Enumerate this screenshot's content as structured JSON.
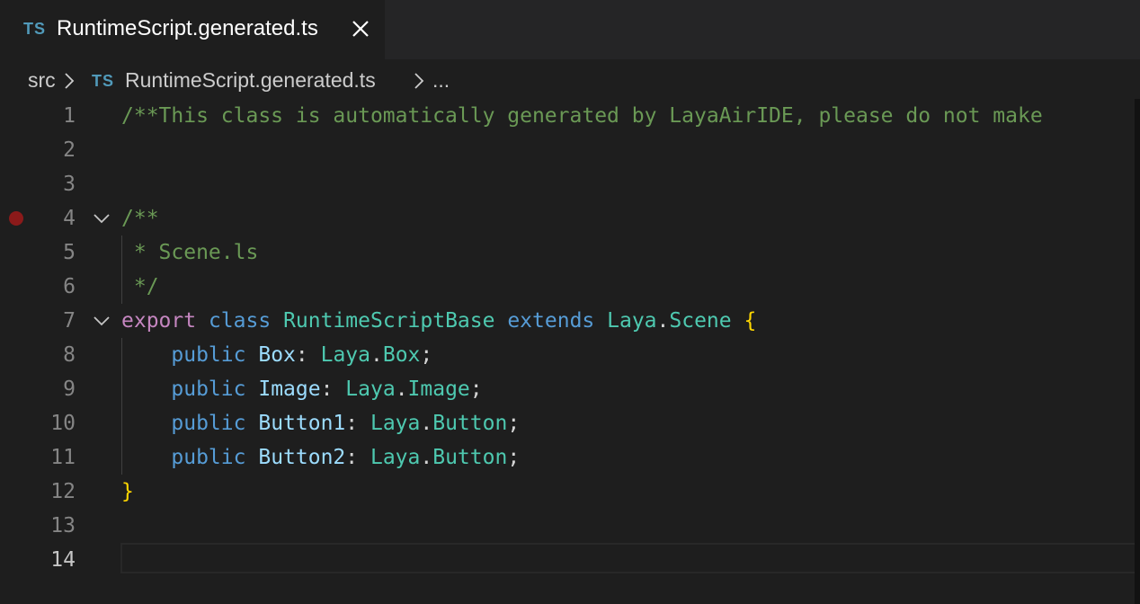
{
  "tab": {
    "icon_text": "TS",
    "label": "RuntimeScript.generated.ts"
  },
  "breadcrumb": {
    "folder": "src",
    "icon_text": "TS",
    "file": "RuntimeScript.generated.ts",
    "more": "..."
  },
  "editor": {
    "current_line": 14,
    "breakpoint_line": 4,
    "lines": [
      {
        "n": "1",
        "tokens": [
          {
            "t": "/**This class is automatically generated by LayaAirIDE, please do not make",
            "c": "c-comment"
          }
        ]
      },
      {
        "n": "2",
        "tokens": []
      },
      {
        "n": "3",
        "tokens": []
      },
      {
        "n": "4",
        "tokens": [
          {
            "t": "/**",
            "c": "c-comment"
          }
        ]
      },
      {
        "n": "5",
        "tokens": [
          {
            "t": " * Scene.ls",
            "c": "c-comment"
          }
        ]
      },
      {
        "n": "6",
        "tokens": [
          {
            "t": " */",
            "c": "c-comment"
          }
        ]
      },
      {
        "n": "7",
        "tokens": [
          {
            "t": "export",
            "c": "c-kw-export"
          },
          {
            "t": " ",
            "c": "c-punct"
          },
          {
            "t": "class",
            "c": "c-keyword"
          },
          {
            "t": " ",
            "c": "c-punct"
          },
          {
            "t": "RuntimeScriptBase",
            "c": "c-type"
          },
          {
            "t": " ",
            "c": "c-punct"
          },
          {
            "t": "extends",
            "c": "c-keyword"
          },
          {
            "t": " ",
            "c": "c-punct"
          },
          {
            "t": "Laya",
            "c": "c-type"
          },
          {
            "t": ".",
            "c": "c-punct"
          },
          {
            "t": "Scene",
            "c": "c-type"
          },
          {
            "t": " ",
            "c": "c-punct"
          },
          {
            "t": "{",
            "c": "c-brace"
          }
        ]
      },
      {
        "n": "8",
        "tokens": [
          {
            "t": "    ",
            "c": "c-punct"
          },
          {
            "t": "public",
            "c": "c-keyword"
          },
          {
            "t": " ",
            "c": "c-punct"
          },
          {
            "t": "Box",
            "c": "c-prop"
          },
          {
            "t": ": ",
            "c": "c-punct"
          },
          {
            "t": "Laya",
            "c": "c-type"
          },
          {
            "t": ".",
            "c": "c-punct"
          },
          {
            "t": "Box",
            "c": "c-type"
          },
          {
            "t": ";",
            "c": "c-punct"
          }
        ]
      },
      {
        "n": "9",
        "tokens": [
          {
            "t": "    ",
            "c": "c-punct"
          },
          {
            "t": "public",
            "c": "c-keyword"
          },
          {
            "t": " ",
            "c": "c-punct"
          },
          {
            "t": "Image",
            "c": "c-prop"
          },
          {
            "t": ": ",
            "c": "c-punct"
          },
          {
            "t": "Laya",
            "c": "c-type"
          },
          {
            "t": ".",
            "c": "c-punct"
          },
          {
            "t": "Image",
            "c": "c-type"
          },
          {
            "t": ";",
            "c": "c-punct"
          }
        ]
      },
      {
        "n": "10",
        "tokens": [
          {
            "t": "    ",
            "c": "c-punct"
          },
          {
            "t": "public",
            "c": "c-keyword"
          },
          {
            "t": " ",
            "c": "c-punct"
          },
          {
            "t": "Button1",
            "c": "c-prop"
          },
          {
            "t": ": ",
            "c": "c-punct"
          },
          {
            "t": "Laya",
            "c": "c-type"
          },
          {
            "t": ".",
            "c": "c-punct"
          },
          {
            "t": "Button",
            "c": "c-type"
          },
          {
            "t": ";",
            "c": "c-punct"
          }
        ]
      },
      {
        "n": "11",
        "tokens": [
          {
            "t": "    ",
            "c": "c-punct"
          },
          {
            "t": "public",
            "c": "c-keyword"
          },
          {
            "t": " ",
            "c": "c-punct"
          },
          {
            "t": "Button2",
            "c": "c-prop"
          },
          {
            "t": ": ",
            "c": "c-punct"
          },
          {
            "t": "Laya",
            "c": "c-type"
          },
          {
            "t": ".",
            "c": "c-punct"
          },
          {
            "t": "Button",
            "c": "c-type"
          },
          {
            "t": ";",
            "c": "c-punct"
          }
        ]
      },
      {
        "n": "12",
        "tokens": [
          {
            "t": "}",
            "c": "c-brace"
          }
        ]
      },
      {
        "n": "13",
        "tokens": []
      },
      {
        "n": "14",
        "tokens": []
      }
    ],
    "fold_lines": [
      4,
      7
    ]
  },
  "colors": {
    "background": "#1e1e1e",
    "tab_bar": "#252526",
    "ts_icon": "#519aba",
    "comment": "#6a9955",
    "keyword": "#569cd6",
    "export_keyword": "#c586c0",
    "type": "#4ec9b0",
    "property": "#9cdcfe",
    "brace": "#ffd700",
    "breakpoint": "#8b1a1a"
  }
}
